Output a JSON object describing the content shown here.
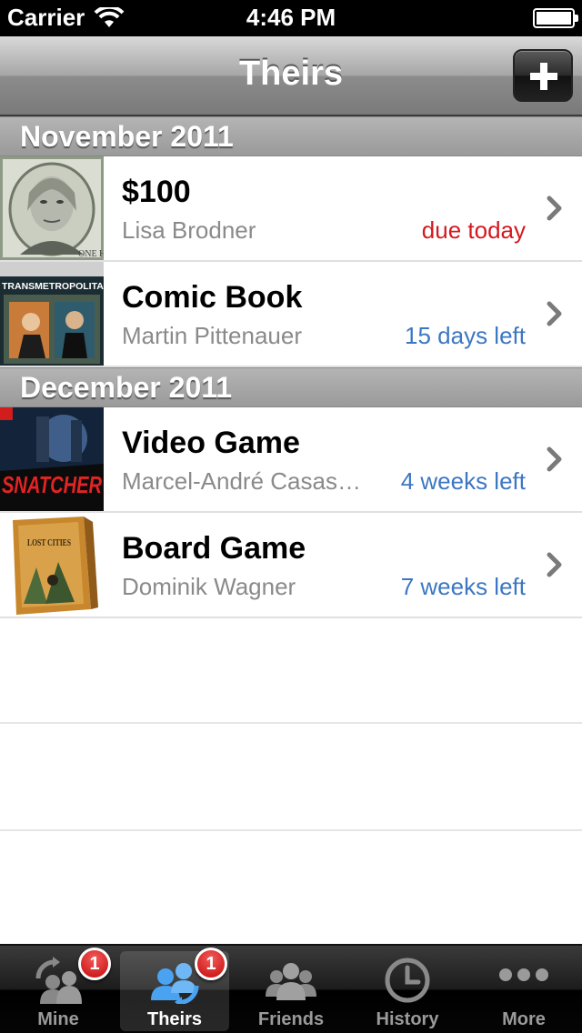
{
  "status_bar": {
    "carrier": "Carrier",
    "time": "4:46 PM",
    "battery_level": 0.95
  },
  "nav": {
    "title": "Theirs",
    "add_icon": "plus-icon"
  },
  "sections": [
    {
      "header": "November 2011",
      "items": [
        {
          "title": "$100",
          "person": "Lisa Brodner",
          "due": "due today",
          "due_color": "#d3191f",
          "thumb": "hundred-dollar-bill"
        },
        {
          "title": "Comic Book",
          "person": "Martin Pittenauer",
          "due": "15 days left",
          "due_color": "#3d77c2",
          "thumb": "transmetropolitan-comic-cover"
        }
      ]
    },
    {
      "header": "December 2011",
      "items": [
        {
          "title": "Video Game",
          "person": "Marcel-André Casas…",
          "due": "4 weeks left",
          "due_color": "#3d77c2",
          "thumb": "snatcher-game-cover"
        },
        {
          "title": "Board Game",
          "person": "Dominik Wagner",
          "due": "7 weeks left",
          "due_color": "#3d77c2",
          "thumb": "lost-cities-box"
        }
      ]
    }
  ],
  "thumb_text": {
    "comic": "TRANSMETROPOLITAN",
    "game": "SNATCHER",
    "board": "LOST CITIES"
  },
  "tab_bar": {
    "tabs": [
      {
        "label": "Mine",
        "icon": "people-return-icon",
        "badge": "1"
      },
      {
        "label": "Theirs",
        "icon": "people-lend-icon",
        "badge": "1",
        "selected": true
      },
      {
        "label": "Friends",
        "icon": "group-icon"
      },
      {
        "label": "History",
        "icon": "clock-icon"
      },
      {
        "label": "More",
        "icon": "more-dots-icon"
      }
    ]
  },
  "colors": {
    "due_red": "#d3191f",
    "due_blue": "#3d77c2",
    "badge_red": "#d01111",
    "selected_tab_blue": "#4aa3f0"
  }
}
